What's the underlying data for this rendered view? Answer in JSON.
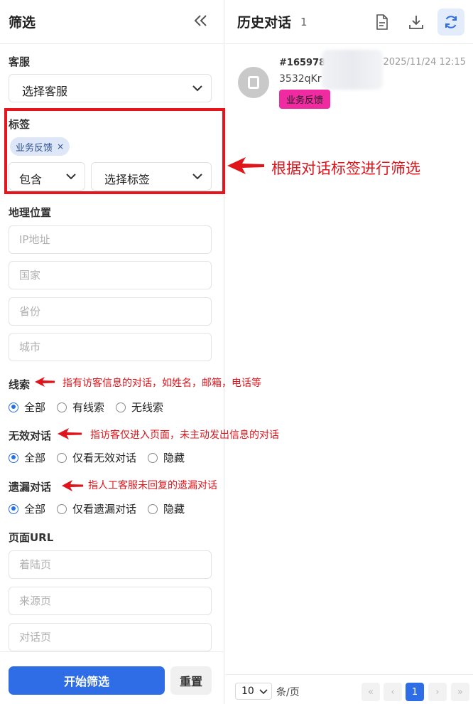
{
  "filter_panel": {
    "title": "筛选",
    "agent": {
      "label": "客服",
      "select_value": "选择客服"
    },
    "tags": {
      "label": "标签",
      "chips": [
        "业务反馈"
      ],
      "chip_remove": "×",
      "mode_value": "包含",
      "tag_select_value": "选择标签"
    },
    "geo": {
      "label": "地理位置",
      "ip_placeholder": "IP地址",
      "country_placeholder": "国家",
      "province_placeholder": "省份",
      "city_placeholder": "城市"
    },
    "leads": {
      "label": "线索",
      "options": [
        "全部",
        "有线索",
        "无线索"
      ],
      "selected": 0
    },
    "invalid": {
      "label": "无效对话",
      "options": [
        "全部",
        "仅看无效对话",
        "隐藏"
      ],
      "selected": 0
    },
    "missed": {
      "label": "遗漏对话",
      "options": [
        "全部",
        "仅看遗漏对话",
        "隐藏"
      ],
      "selected": 0
    },
    "url": {
      "label": "页面URL",
      "landing_placeholder": "着陆页",
      "referrer_placeholder": "来源页",
      "chat_placeholder": "对话页"
    },
    "apply_label": "开始筛选",
    "reset_label": "重置"
  },
  "annotations": {
    "tags": "根据对话标签进行筛选",
    "leads": "指有访客信息的对话，如姓名，邮箱，电话等",
    "invalid": "指访客仅进入页面，未主动发出信息的对话",
    "missed": "指人工客服未回复的遗漏对话"
  },
  "history": {
    "title": "历史对话",
    "count": "1",
    "conversations": [
      {
        "id": "#165978",
        "subtitle": "3532qKr",
        "time": "2025/11/24 12:15",
        "tag": "业务反馈"
      }
    ]
  },
  "pagination": {
    "page_size": "10",
    "per_label": "条/页",
    "first": "«",
    "prev": "‹",
    "current": "1",
    "next": "›",
    "last": "»"
  },
  "colors": {
    "primary": "#2f6de6",
    "annotation_red": "#e0141b",
    "tag_pink": "#f02aa0",
    "chip_bg": "#dde7f8"
  }
}
